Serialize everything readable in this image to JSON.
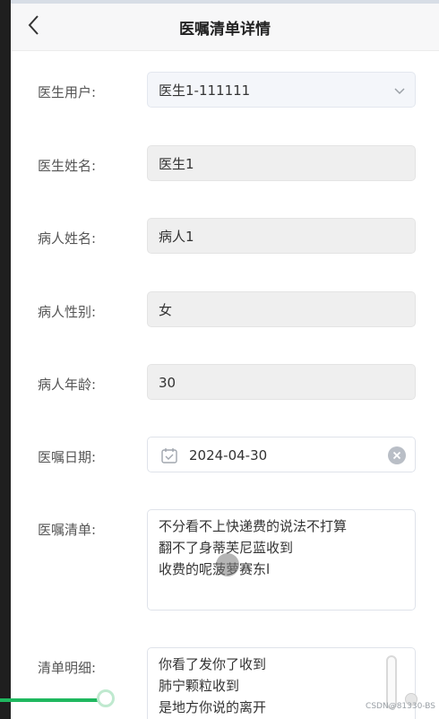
{
  "header": {
    "title": "医嘱清单详情"
  },
  "form": {
    "doctor_user": {
      "label": "医生用户:",
      "value": "医生1-111111"
    },
    "doctor_name": {
      "label": "医生姓名:",
      "value": "医生1"
    },
    "patient_name": {
      "label": "病人姓名:",
      "value": "病人1"
    },
    "patient_gender": {
      "label": "病人性别:",
      "value": "女"
    },
    "patient_age": {
      "label": "病人年龄:",
      "value": "30"
    },
    "order_date": {
      "label": "医嘱日期:",
      "value": "2024-04-30"
    },
    "order_list": {
      "label": "医嘱清单:",
      "lines": [
        "不分看不上快递费的说法不打算",
        "翻不了身蒂芙尼蓝收到",
        "收费的呢菠萝赛东l"
      ]
    },
    "list_detail": {
      "label": "清单明细:",
      "lines": [
        "你看了发你了收到",
        "肺宁颗粒收到",
        "是地方你说的离开"
      ]
    }
  },
  "watermark": "CSDN@81330-BS",
  "colors": {
    "accent_green": "#1fb85f",
    "disabled_bg": "#efefef"
  }
}
